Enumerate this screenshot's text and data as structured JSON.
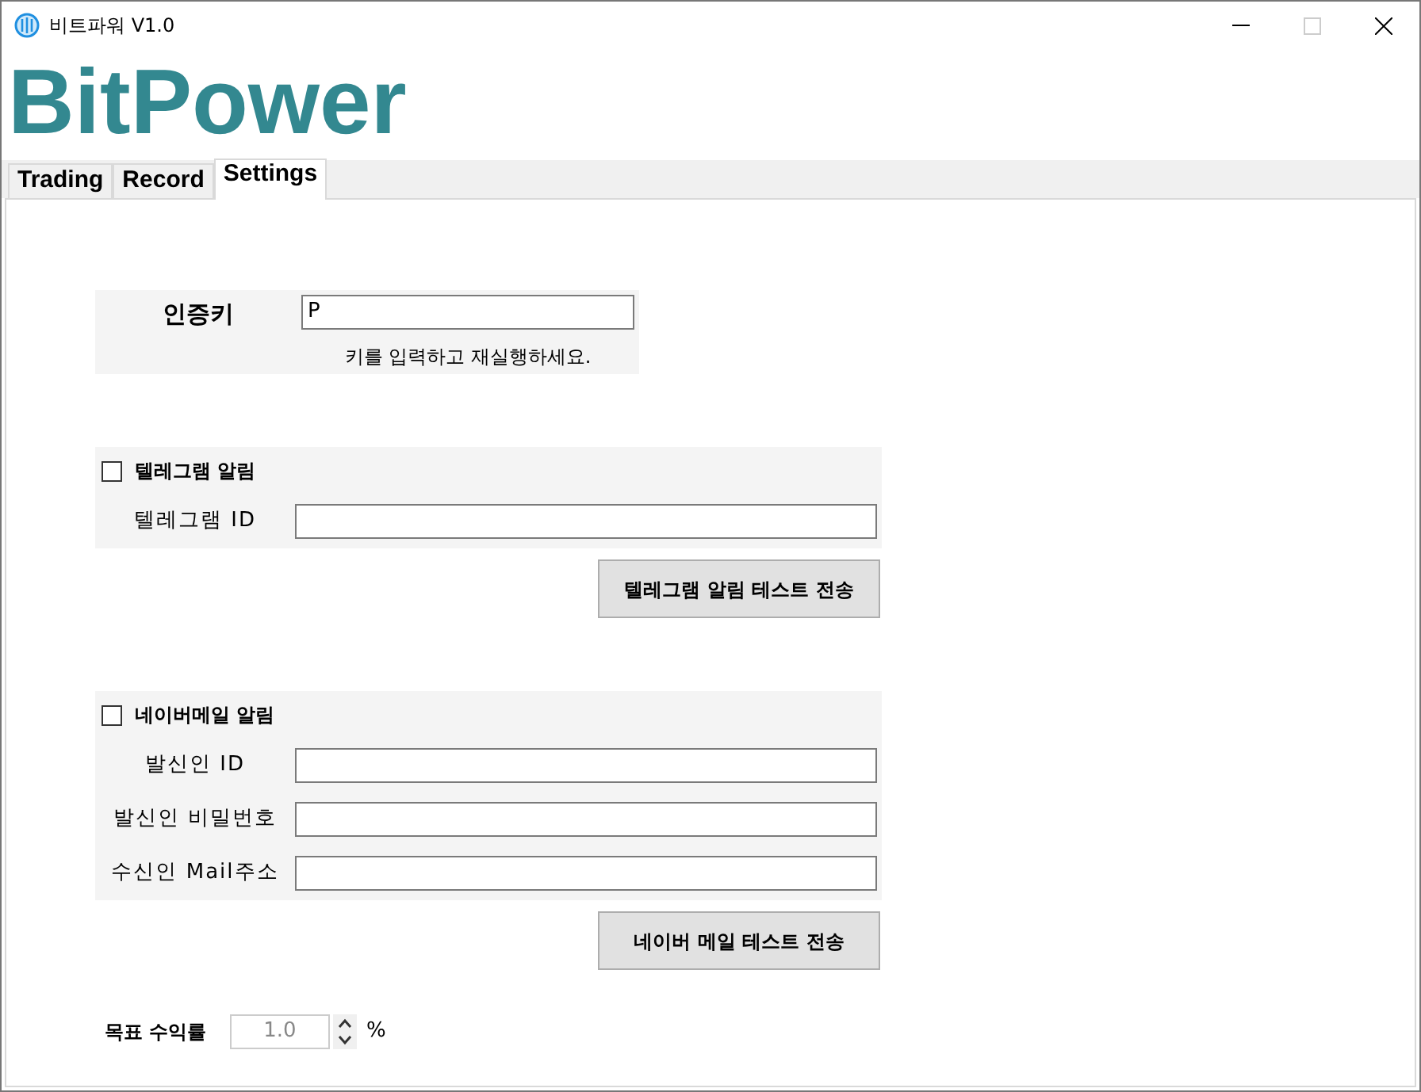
{
  "window": {
    "title": "비트파워 V1.0"
  },
  "logo": "BitPower",
  "tabs": [
    {
      "label": "Trading",
      "selected": false
    },
    {
      "label": "Record",
      "selected": false
    },
    {
      "label": "Settings",
      "selected": true
    }
  ],
  "auth": {
    "label": "인증키",
    "value": "P",
    "hint": "키를 입력하고 재실행하세요."
  },
  "alerts": [
    {
      "label": "텔레그램 알림",
      "checked": false,
      "fields": [
        {
          "label": "텔레그램 ID"
        }
      ],
      "button": "텔레그램 알림 테스트 전송"
    },
    {
      "label": "네이버메일 알림",
      "checked": false,
      "fields": [
        {
          "label": "발신인 ID"
        },
        {
          "label": "발신인 비밀번호"
        },
        {
          "label": "수신인 Mail주소"
        }
      ],
      "button": "네이버 메일 테스트 전송"
    }
  ],
  "target": {
    "label": "목표 수익률",
    "value": "1.0",
    "disabled": true,
    "unit": "%"
  }
}
